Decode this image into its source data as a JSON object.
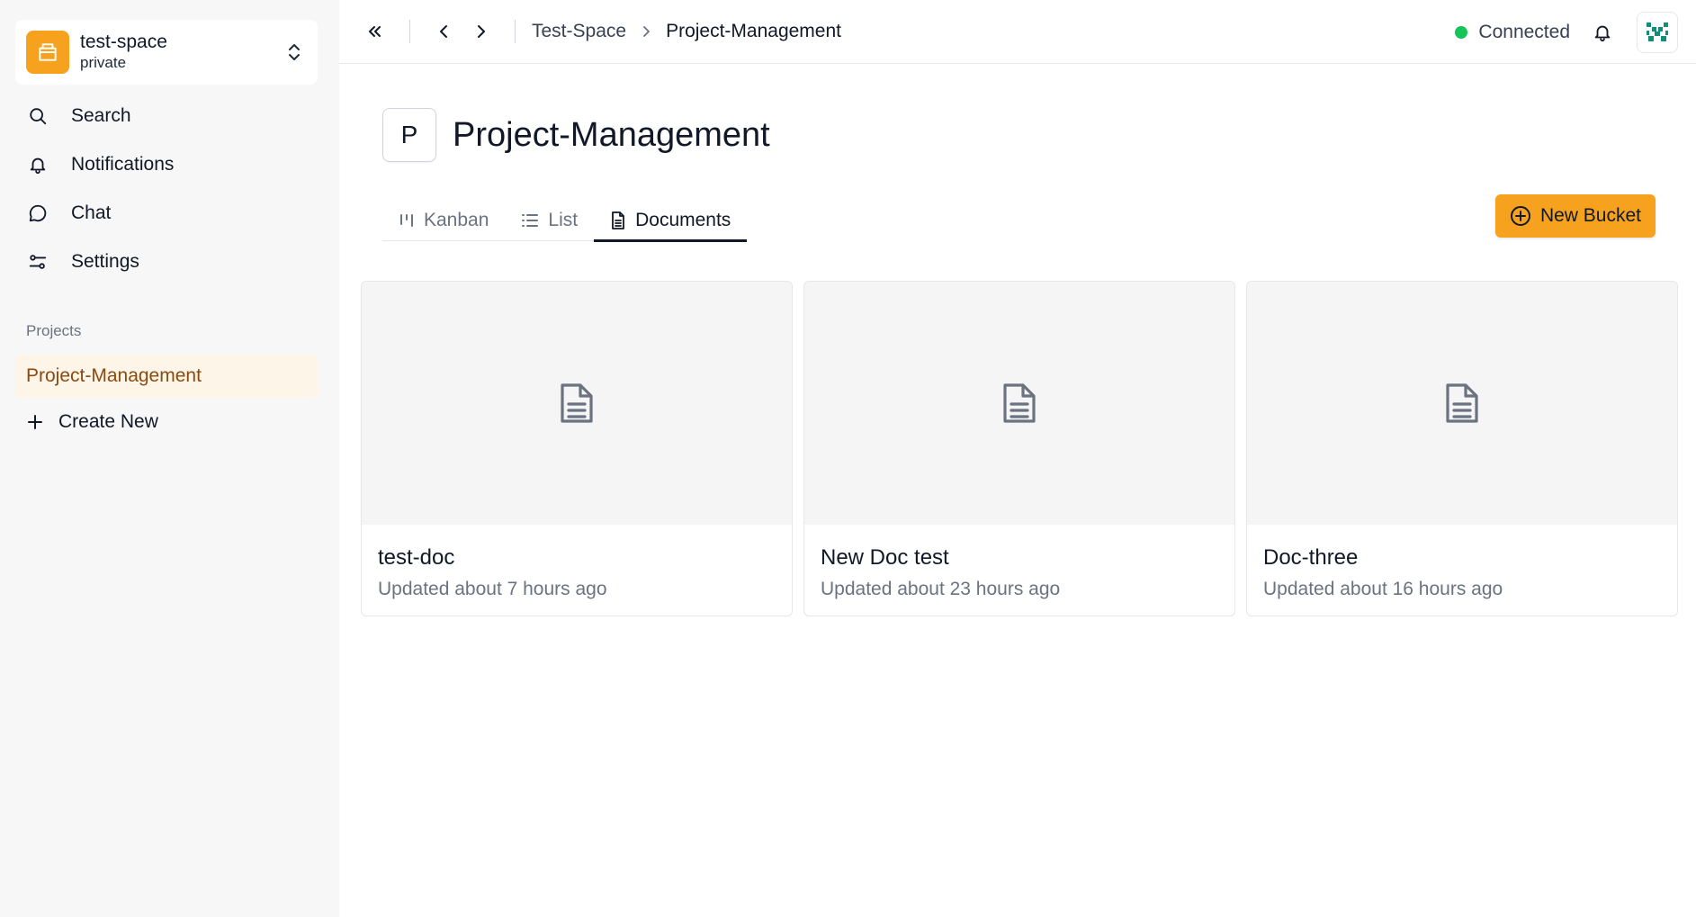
{
  "workspace": {
    "name": "test-space",
    "privacy": "private"
  },
  "nav": [
    {
      "label": "Search",
      "icon": "search-icon"
    },
    {
      "label": "Notifications",
      "icon": "bell-icon"
    },
    {
      "label": "Chat",
      "icon": "chat-bubble-icon"
    },
    {
      "label": "Settings",
      "icon": "sliders-icon"
    }
  ],
  "sidebar": {
    "projects_label": "Projects",
    "active_project": "Project-Management",
    "create_new": "Create New"
  },
  "topbar": {
    "breadcrumb": [
      "Test-Space",
      "Project-Management"
    ],
    "status": "Connected"
  },
  "page": {
    "badge": "P",
    "title": "Project-Management",
    "tabs": [
      {
        "label": "Kanban",
        "icon": "kanban-icon"
      },
      {
        "label": "List",
        "icon": "list-icon"
      },
      {
        "label": "Documents",
        "icon": "document-icon",
        "active": true
      }
    ],
    "new_bucket": "New Bucket"
  },
  "documents": [
    {
      "title": "test-doc",
      "updated": "Updated about 7 hours ago"
    },
    {
      "title": "New Doc test",
      "updated": "Updated about 23 hours ago"
    },
    {
      "title": "Doc-three",
      "updated": "Updated about 16 hours ago"
    }
  ],
  "colors": {
    "accent": "#f6a21e",
    "active_project_bg": "#fdf5e7",
    "active_project_text": "#8b4a10",
    "connected": "#16c45a",
    "avatar_teal": "#0f8f7a"
  }
}
